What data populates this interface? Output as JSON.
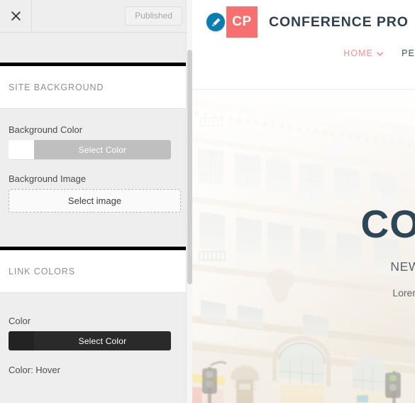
{
  "customizer": {
    "header": {
      "close_icon": "close-icon",
      "publish_label": "Published"
    },
    "sections": [
      {
        "id": "site-background",
        "title": "SITE BACKGROUND",
        "fields": [
          {
            "type": "color",
            "label": "Background Color",
            "button_label": "Select Color",
            "swatch_color": "#ffffff",
            "button_bg": "#bfbfbf",
            "button_text_color": "#ffffff"
          },
          {
            "type": "image",
            "label": "Background Image",
            "button_label": "Select image"
          }
        ]
      },
      {
        "id": "link-colors",
        "title": "LINK COLORS",
        "fields": [
          {
            "type": "color",
            "label": "Color",
            "button_label": "Select Color",
            "swatch_color": "#232323",
            "button_bg": "#2a2a2a",
            "button_text_color": "#ffffff"
          },
          {
            "type": "color",
            "label": "Color: Hover",
            "button_label": "",
            "swatch_color": "",
            "button_bg": "",
            "button_text_color": ""
          }
        ]
      }
    ]
  },
  "preview": {
    "edit_shortcut_icon": "pencil-edit-icon",
    "logo_initials": "CP",
    "brand_name": "CONFERENCE PRO",
    "logo_color": "#f5706f",
    "brand_text_color": "#31404d",
    "nav": [
      {
        "label": "HOME",
        "has_caret": true,
        "active": true
      },
      {
        "label": "PE",
        "has_caret": false,
        "active": false
      }
    ],
    "hero": {
      "title": "CO",
      "subtitle": "NEW",
      "description": "Lorem",
      "title_color": "#2e4756"
    }
  }
}
